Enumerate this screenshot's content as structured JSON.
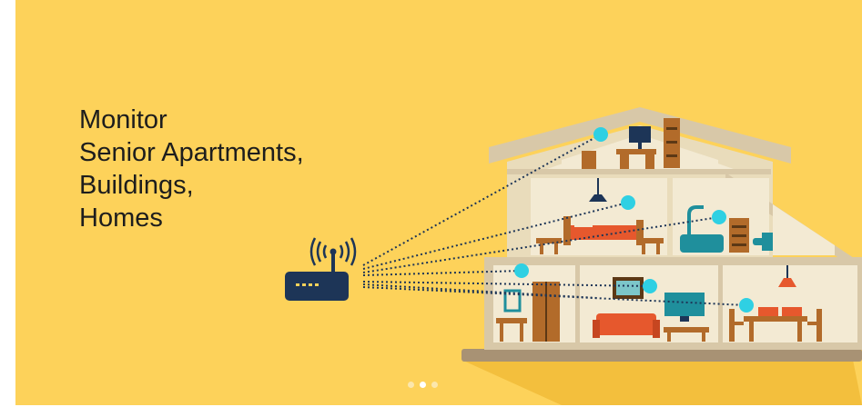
{
  "hero": {
    "headline_lines": [
      "Monitor",
      "Senior Apartments,",
      "Buildings,",
      "Homes"
    ]
  },
  "carousel": {
    "slide_count": 3,
    "active_index": 1
  },
  "icons": [
    "wifi-router-icon",
    "sensor-dot-icon"
  ],
  "colors": {
    "background": "#fdd25a",
    "house_wall": "#ece1c5",
    "house_frame": "#d8c8a8",
    "sensor": "#2fd0e3",
    "router": "#1d3557",
    "wire": "#1d3557"
  }
}
